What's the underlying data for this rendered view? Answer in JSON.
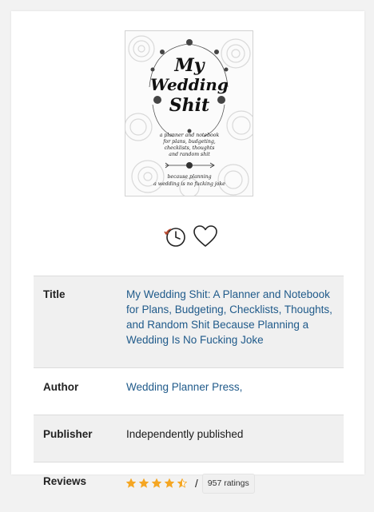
{
  "book": {
    "cover_title_line1": "My",
    "cover_title_line2": "Wedding",
    "cover_title_line3": "Shit",
    "cover_subtitle_lines": [
      "a planner and notebook",
      "for plans, budgeting,",
      "checklists, thoughts",
      "and random shit"
    ],
    "cover_tagline_lines": [
      "because planning",
      "a wedding is no fucking joke"
    ]
  },
  "actions": {
    "read_later_icon": "clock-with-arrow-icon",
    "favorite_icon": "heart-outline-icon"
  },
  "details": {
    "title_label": "Title",
    "title_value": "My Wedding Shit: A Planner and Notebook for Plans, Budgeting, Checklists, Thoughts, and Random Shit Because Planning a Wedding Is No Fucking Joke",
    "author_label": "Author",
    "author_value": "Wedding Planner Press,",
    "publisher_label": "Publisher",
    "publisher_value": "Independently published",
    "reviews_label": "Reviews",
    "rating_value": 4.5,
    "rating_max": 5,
    "separator": "/",
    "ratings_count": "957 ratings"
  },
  "colors": {
    "link": "#1f5a8a",
    "star": "#f5a623",
    "row_shade": "#f0f0f0"
  }
}
